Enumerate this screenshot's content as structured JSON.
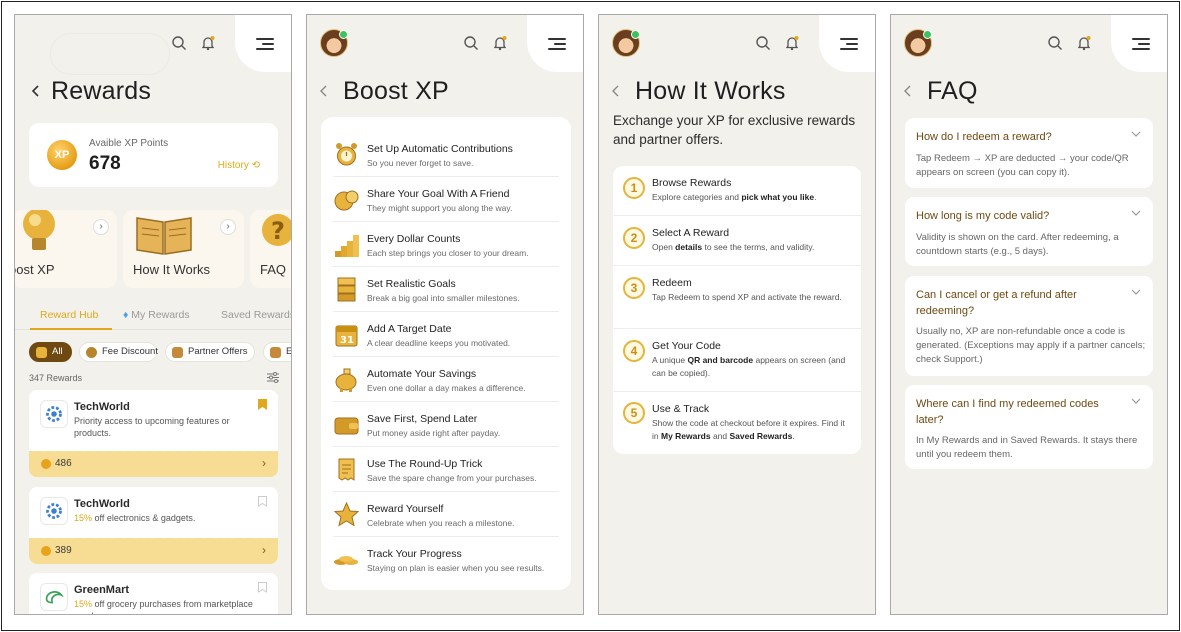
{
  "rewards": {
    "title": "Rewards",
    "xp_label": "Avaible XP Points",
    "xp_value": "678",
    "xp_coin": "XP",
    "history": "History",
    "tiles": [
      "oost XP",
      "How It Works",
      "FAQ"
    ],
    "tabs": [
      "Reward Hub",
      "My Rewards",
      "Saved Rewards"
    ],
    "chips": [
      "All",
      "Fee Discount",
      "Partner Offers",
      "E"
    ],
    "count": "347 Rewards",
    "cards": [
      {
        "title": "TechWorld",
        "desc": "Priority access to upcoming features or products.",
        "highlight": "",
        "points": "486"
      },
      {
        "title": "TechWorld",
        "desc": " off electronics & gadgets.",
        "highlight": "15%",
        "points": "389"
      },
      {
        "title": "GreenMart",
        "desc": " off grocery purchases from marketplace vendors",
        "highlight": "15%",
        "points": ""
      }
    ]
  },
  "boost": {
    "title": "Boost XP",
    "items": [
      {
        "title": "Set Up Automatic Contributions",
        "sub": "So you never forget to save.",
        "icon": "alarm-clock-icon"
      },
      {
        "title": "Share Your Goal With A Friend",
        "sub": "They might support you along the way.",
        "icon": "coin-share-icon"
      },
      {
        "title": "Every Dollar Counts",
        "sub": "Each step brings you closer to your dream.",
        "icon": "rising-stairs-icon"
      },
      {
        "title": "Set Realistic Goals",
        "sub": "Break a big goal into smaller milestones.",
        "icon": "stacked-blocks-icon"
      },
      {
        "title": "Add A Target Date",
        "sub": "A clear deadline keeps you motivated.",
        "icon": "calendar-icon"
      },
      {
        "title": "Automate Your Savings",
        "sub": "Even one dollar a day makes a difference.",
        "icon": "piggy-bank-icon"
      },
      {
        "title": "Save First, Spend Later",
        "sub": "Put money aside right after payday.",
        "icon": "wallet-icon"
      },
      {
        "title": "Use The Round-Up Trick",
        "sub": "Save the spare change from your purchases.",
        "icon": "receipt-icon"
      },
      {
        "title": "Reward Yourself",
        "sub": "Celebrate when you reach a milestone.",
        "icon": "star-icon"
      },
      {
        "title": "Track Your Progress",
        "sub": "Staying on plan is easier when you see results.",
        "icon": "coins-icon"
      }
    ]
  },
  "how": {
    "title": "How It Works",
    "intro": "Exchange your XP for exclusive rewards and partner offers.",
    "steps": [
      {
        "n": "1",
        "title": "Browse Rewards",
        "desc_a": "Explore categories and ",
        "desc_b": "pick what you like",
        "desc_c": ".",
        "desc_d": "",
        "desc_e": ""
      },
      {
        "n": "2",
        "title": "Select A Reward",
        "desc_a": "Open ",
        "desc_b": "details",
        "desc_c": " to see the terms, and validity.",
        "desc_d": "",
        "desc_e": ""
      },
      {
        "n": "3",
        "title": "Redeem",
        "desc_a": "Tap Redeem to spend XP and activate the reward.",
        "desc_b": "",
        "desc_c": "",
        "desc_d": "",
        "desc_e": ""
      },
      {
        "n": "4",
        "title": "Get Your Code",
        "desc_a": "A unique ",
        "desc_b": "QR and barcode",
        "desc_c": " appears on screen (and can be copied).",
        "desc_d": "",
        "desc_e": ""
      },
      {
        "n": "5",
        "title": "Use & Track",
        "desc_a": "Show the code at checkout before it expires. Find it in ",
        "desc_b": "My Rewards",
        "desc_c": " and ",
        "desc_d": "Saved Rewards",
        "desc_e": "."
      }
    ]
  },
  "faq": {
    "title": "FAQ",
    "items": [
      {
        "q": "How do I redeem a reward?",
        "a": "Tap Redeem → XP are deducted → your code/QR appears on screen (you can copy it)."
      },
      {
        "q": "How long is my code valid?",
        "a": "Validity is shown on the card. After redeeming, a countdown starts (e.g., 5 days)."
      },
      {
        "q": "Can I cancel or get a refund after redeeming?",
        "a": "Usually no, XP are non-refundable once a code is generated. (Exceptions may apply if a partner cancels; check Support.)"
      },
      {
        "q": "Where can I find my redeemed codes later?",
        "a": "In My Rewards and in Saved Rewards. It stays there until you redeem them."
      }
    ]
  },
  "colors": {
    "accent": "#e0a91d",
    "brown": "#6e4a12",
    "background": "#f2f1ec"
  }
}
